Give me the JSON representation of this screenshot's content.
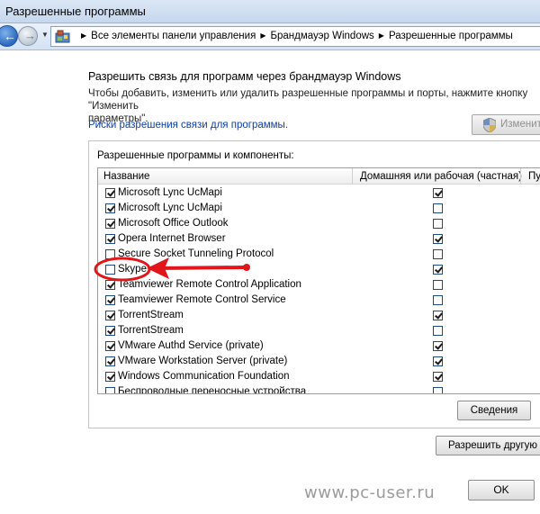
{
  "window": {
    "title": "Разрешенные программы"
  },
  "address": {
    "crumbs": [
      "Все элементы панели управления",
      "Брандмауэр Windows",
      "Разрешенные программы"
    ]
  },
  "content": {
    "heading": "Разрешить связь для программ через брандмауэр Windows",
    "description": "Чтобы добавить, изменить или удалить разрешенные программы и порты, нажмите кнопку \"Изменить\nпараметры\".",
    "risk_link": "Риски разрешения связи для программы.",
    "change_button": "Изменить"
  },
  "group": {
    "title": "Разрешенные программы и компоненты:",
    "columns": [
      "Название",
      "Домашняя или рабочая (частная)",
      "Пу"
    ],
    "rows": [
      {
        "name": "Microsoft Lync UcMapi",
        "enabled": true,
        "private": true
      },
      {
        "name": "Microsoft Lync UcMapi",
        "enabled": true,
        "private": false
      },
      {
        "name": "Microsoft Office Outlook",
        "enabled": true,
        "private": false
      },
      {
        "name": "Opera Internet Browser",
        "enabled": true,
        "private": true
      },
      {
        "name": "Secure Socket Tunneling Protocol",
        "enabled": false,
        "private": false
      },
      {
        "name": "Skype",
        "enabled": false,
        "private": true
      },
      {
        "name": "Teamviewer Remote Control Application",
        "enabled": true,
        "private": false
      },
      {
        "name": "Teamviewer Remote Control Service",
        "enabled": true,
        "private": false
      },
      {
        "name": "TorrentStream",
        "enabled": true,
        "private": true
      },
      {
        "name": "TorrentStream",
        "enabled": true,
        "private": false
      },
      {
        "name": "VMware Authd Service (private)",
        "enabled": true,
        "private": true
      },
      {
        "name": "VMware Workstation Server (private)",
        "enabled": true,
        "private": true
      },
      {
        "name": "Windows Communication Foundation",
        "enabled": true,
        "private": true
      },
      {
        "name": "Беспроводные переносные устройства",
        "enabled": false,
        "private": false
      }
    ],
    "details_button": "Сведения",
    "allow_other_button": "Разрешить другую п"
  },
  "footer": {
    "ok_button": "OK",
    "watermark": "www.pc-user.ru"
  },
  "annotation": {
    "color": "#e0161b",
    "highlighted_row": "Skype"
  }
}
